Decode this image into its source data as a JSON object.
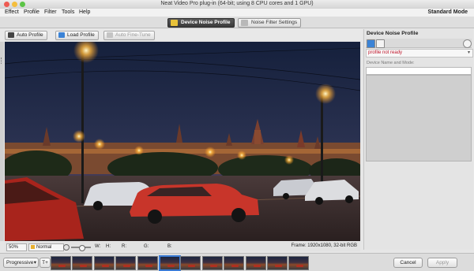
{
  "window": {
    "title": "Neat Video Pro plug-in (64-bit; using 8 CPU cores and 1 GPU)",
    "mode": "Standard Mode",
    "menu": [
      "Effect",
      "Profile",
      "Filter",
      "Tools",
      "Help"
    ]
  },
  "tabs": {
    "device_noise_profile": "Device Noise Profile",
    "noise_filter_settings": "Noise Filter Settings"
  },
  "toolbar": {
    "auto_profile": "Auto Profile",
    "load_profile": "Load Profile",
    "auto_fine_tune": "Auto Fine-Tune"
  },
  "status": {
    "zoom": "50%",
    "view_mode": "Normal",
    "w_label": "W:",
    "h_label": "H:",
    "r_label": "R:",
    "g_label": "G:",
    "b_label": "B:",
    "frame": "Frame: 1920x1080, 32-bit RGB"
  },
  "bottom": {
    "scan": "Progressive",
    "t_button": "T+",
    "cancel": "Cancel",
    "apply": "Apply",
    "thumbnail_count": 12,
    "selected_thumbnail": 5
  },
  "panel": {
    "title": "Device Noise Profile",
    "status": "profile not ready",
    "name_label": "Device Name and Mode:"
  },
  "colors": {
    "active_tab": "#3a3a3a",
    "status_red": "#c0152a",
    "selection_blue": "#3a7bd5"
  }
}
